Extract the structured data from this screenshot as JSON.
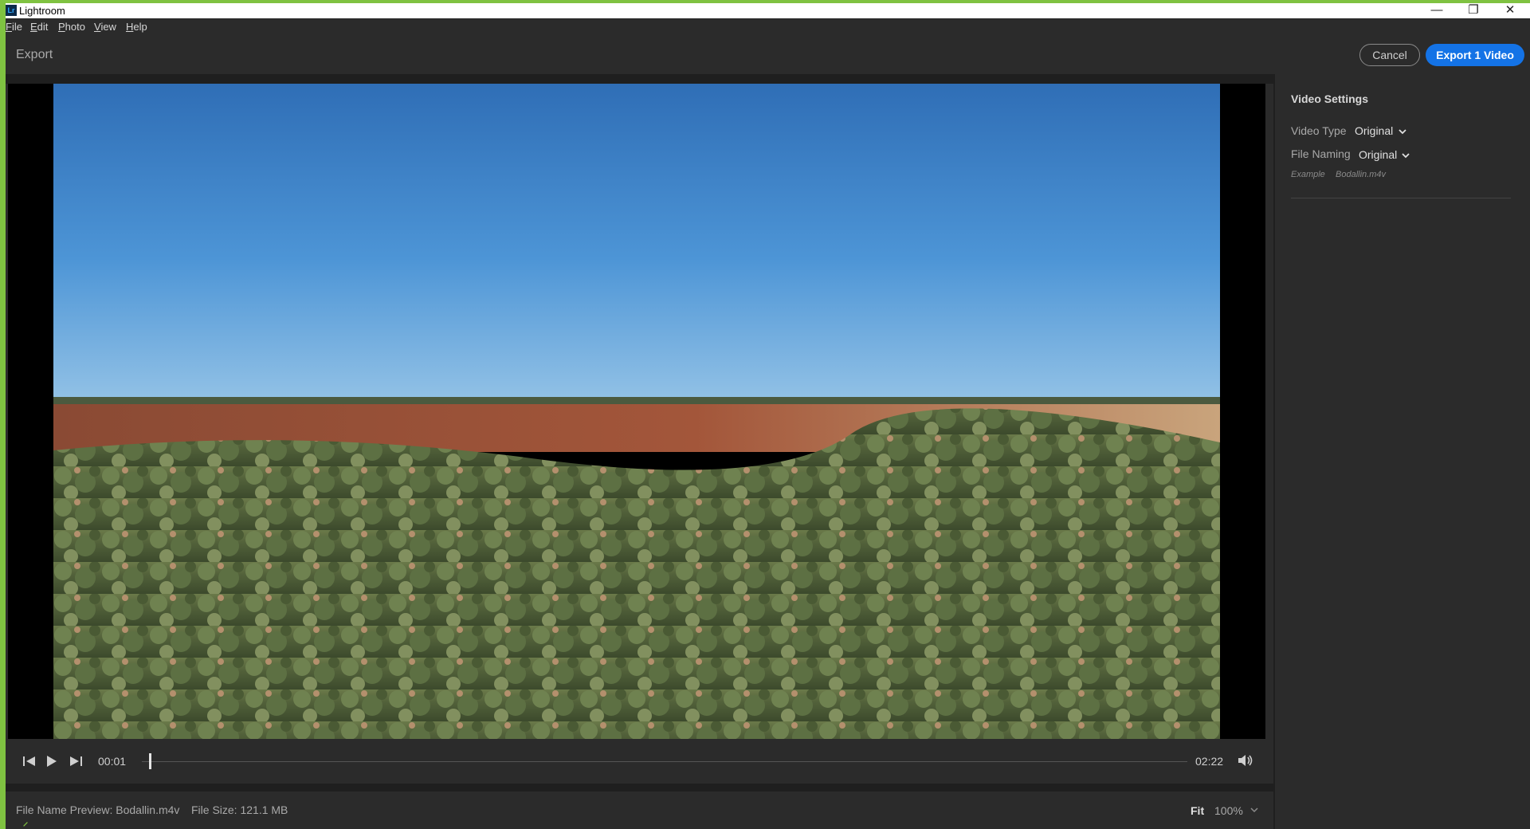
{
  "window": {
    "app_logo": "Lr",
    "title": "Lightroom",
    "controls": [
      "minimize-icon",
      "restore-icon",
      "close-icon"
    ]
  },
  "menu": {
    "items": [
      {
        "first": "F",
        "rest": "ile"
      },
      {
        "first": "E",
        "rest": "dit"
      },
      {
        "first": "P",
        "rest": "hoto"
      },
      {
        "first": "V",
        "rest": "iew"
      },
      {
        "first": "H",
        "rest": "elp"
      }
    ]
  },
  "toolbar": {
    "title": "Export",
    "cancel_label": "Cancel",
    "export_label": "Export 1 Video"
  },
  "player": {
    "current_time": "00:01",
    "total_time": "02:22",
    "progress": 0.007
  },
  "footer": {
    "file_name_preview": "File Name Preview: Bodallin.m4v",
    "file_size": "File Size: 121.1 MB",
    "fit_label": "Fit",
    "zoom": "100%"
  },
  "settings": {
    "title": "Video Settings",
    "video_type_label": "Video Type",
    "video_type_value": "Original",
    "file_naming_label": "File Naming",
    "file_naming_value": "Original",
    "example_label": "Example",
    "example_value": "Bodallin.m4v"
  },
  "colors": {
    "accent": "#1473e6",
    "frame": "#7fc241",
    "background": "#2b2b2b"
  }
}
